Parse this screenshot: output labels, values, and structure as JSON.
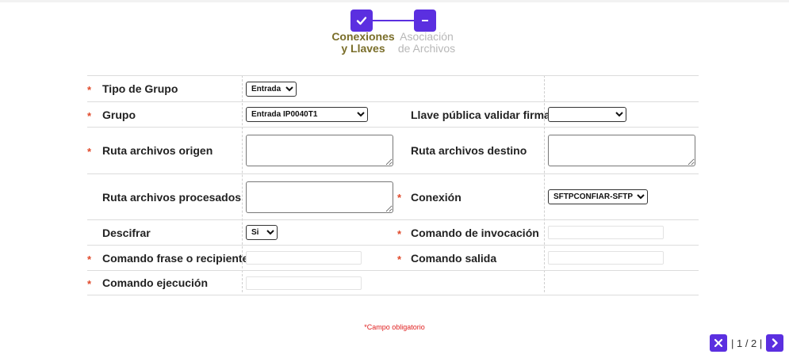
{
  "stepper": {
    "steps": [
      {
        "label_line1": "Conexiones",
        "label_line2": "y Llaves",
        "state": "done",
        "icon": "check-icon"
      },
      {
        "label_line1": "Asociación",
        "label_line2": "de Archivos",
        "state": "pending",
        "icon": "minus-icon"
      }
    ]
  },
  "form": {
    "tipo_grupo": {
      "label": "Tipo de Grupo",
      "value": "Entrada"
    },
    "grupo": {
      "label": "Grupo",
      "value": "Entrada IP0040T1"
    },
    "llave_publica": {
      "label": "Llave pública validar firma",
      "value": ""
    },
    "ruta_origen": {
      "label": "Ruta archivos origen",
      "value": ""
    },
    "ruta_destino": {
      "label": "Ruta archivos destino",
      "value": ""
    },
    "ruta_procesados": {
      "label": "Ruta archivos procesados",
      "value": ""
    },
    "conexion": {
      "label": "Conexión",
      "value": "SFTPCONFIAR-SFTP"
    },
    "descifrar": {
      "label": "Descifrar",
      "value": "Si"
    },
    "comando_invocacion": {
      "label": "Comando de invocación",
      "value": ""
    },
    "comando_frase": {
      "label": "Comando frase o recipiente",
      "value": ""
    },
    "comando_salida": {
      "label": "Comando salida",
      "value": ""
    },
    "comando_ejecucion": {
      "label": "Comando ejecución",
      "value": ""
    },
    "required_mark": "*"
  },
  "footer": {
    "required_note": "*Campo obligatorio"
  },
  "pager": {
    "text": "| 1 / 2 |",
    "close_icon": "close-icon",
    "next_icon": "chevron-right-icon"
  },
  "colors": {
    "accent": "#5b2fe0",
    "step_done_text": "#7a6e2a",
    "step_pending_text": "#b8b8b8",
    "required": "#e0492a"
  }
}
